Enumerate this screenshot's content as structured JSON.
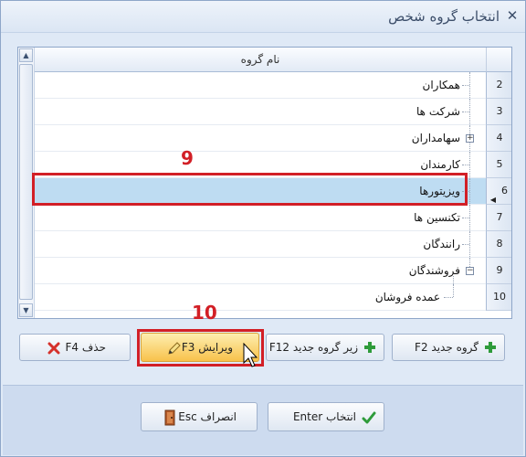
{
  "window": {
    "title": "انتخاب گروه شخص"
  },
  "grid": {
    "column_header": "نام گروه",
    "rows": [
      {
        "num": "2",
        "label": "همکاران"
      },
      {
        "num": "3",
        "label": "شرکت ها"
      },
      {
        "num": "4",
        "label": "سهامداران"
      },
      {
        "num": "5",
        "label": "کارمندان"
      },
      {
        "num": "6",
        "label": "ویزیتورها"
      },
      {
        "num": "7",
        "label": "تکنسین ها"
      },
      {
        "num": "8",
        "label": "رانندگان"
      },
      {
        "num": "9",
        "label": "فروشندگان"
      },
      {
        "num": "10",
        "label": "عمده فروشان"
      }
    ]
  },
  "callouts": {
    "selection": "9",
    "edit_button": "10"
  },
  "buttons": {
    "new_group": "گروه جدید F2",
    "new_subgroup": "زیر گروه جدید F12",
    "edit": "ویرایش F3",
    "delete": "حذف F4",
    "select": "انتخاب Enter",
    "cancel": "انصراف Esc"
  },
  "colors": {
    "accent_red": "#d21f26",
    "selected_row": "#bedcf2",
    "highlight_button": "#f8c24b"
  },
  "icons": {
    "close": "close-icon",
    "plus": "plus-icon",
    "pencil": "pencil-icon",
    "delete": "x-icon",
    "check": "check-icon",
    "door": "door-exit-icon"
  }
}
